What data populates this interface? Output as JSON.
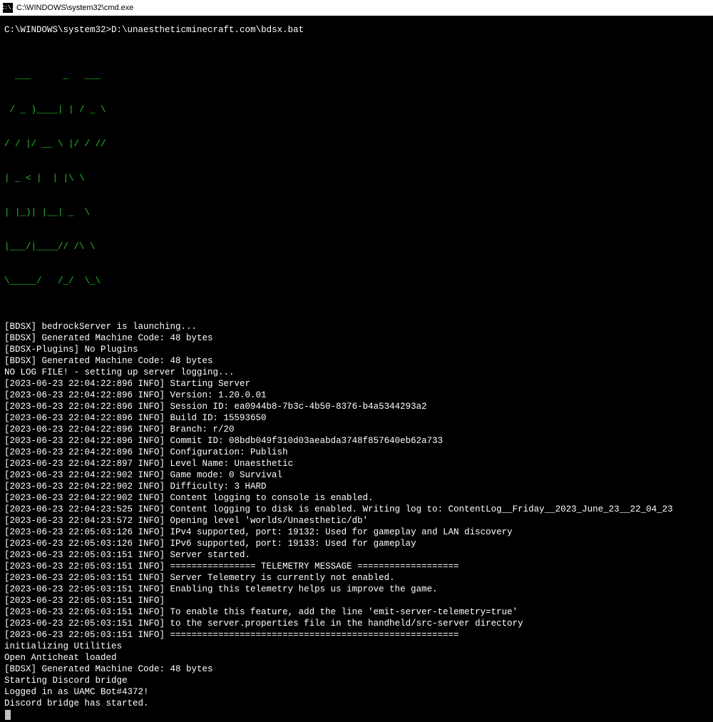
{
  "titlebar": {
    "text": "C:\\WINDOWS\\system32\\cmd.exe",
    "icon_label": "C:\\."
  },
  "prompt": {
    "path": "C:\\WINDOWS\\system32>",
    "cmd": "D:\\unaestheticminecraft.com\\bdsx.bat"
  },
  "logo": {
    "l1": "  ___      _   ___",
    "l2": " / _ )____| | / _ \\",
    "l3": "/ / |/ __ \\ |/ / //",
    "l4": "| _ < |  | |\\ \\",
    "l5": "| |_)| |__| _  \\",
    "l6": "|___/|____// /\\ \\",
    "l7": "\\_____/   /_/  \\_\\"
  },
  "lines": {
    "a01": "[BDSX] bedrockServer is launching...",
    "a02": "[BDSX] Generated Machine Code: 48 bytes",
    "a03": "[BDSX-Plugins] No Plugins",
    "a04": "[BDSX] Generated Machine Code: 48 bytes",
    "a05": "NO LOG FILE! - setting up server logging...",
    "a06": "[2023-06-23 22:04:22:896 INFO] Starting Server",
    "a07": "[2023-06-23 22:04:22:896 INFO] Version: 1.20.0.01",
    "a08": "[2023-06-23 22:04:22:896 INFO] Session ID: ea0944b8-7b3c-4b50-8376-b4a5344293a2",
    "a09": "[2023-06-23 22:04:22:896 INFO] Build ID: 15593650",
    "a10": "[2023-06-23 22:04:22:896 INFO] Branch: r/20",
    "a11": "[2023-06-23 22:04:22:896 INFO] Commit ID: 08bdb049f310d03aeabda3748f857640eb62a733",
    "a12": "[2023-06-23 22:04:22:896 INFO] Configuration: Publish",
    "a13": "[2023-06-23 22:04:22:897 INFO] Level Name: Unaesthetic",
    "a14": "[2023-06-23 22:04:22:902 INFO] Game mode: 0 Survival",
    "a15": "[2023-06-23 22:04:22:902 INFO] Difficulty: 3 HARD",
    "a16": "[2023-06-23 22:04:22:902 INFO] Content logging to console is enabled.",
    "a17": "[2023-06-23 22:04:23:525 INFO] Content logging to disk is enabled. Writing log to: ContentLog__Friday__2023_June_23__22_04_23",
    "a18": "[2023-06-23 22:04:23:572 INFO] Opening level 'worlds/Unaesthetic/db'",
    "a19": "[2023-06-23 22:05:03:126 INFO] IPv4 supported, port: 19132: Used for gameplay and LAN discovery",
    "a20": "[2023-06-23 22:05:03:126 INFO] IPv6 supported, port: 19133: Used for gameplay",
    "a21": "[2023-06-23 22:05:03:151 INFO] Server started.",
    "a22": "[2023-06-23 22:05:03:151 INFO] ================ TELEMETRY MESSAGE ===================",
    "a23": "[2023-06-23 22:05:03:151 INFO] Server Telemetry is currently not enabled.",
    "a24": "[2023-06-23 22:05:03:151 INFO] Enabling this telemetry helps us improve the game.",
    "a25": "[2023-06-23 22:05:03:151 INFO]",
    "a26": "[2023-06-23 22:05:03:151 INFO] To enable this feature, add the line 'emit-server-telemetry=true'",
    "a27": "[2023-06-23 22:05:03:151 INFO] to the server.properties file in the handheld/src-server directory",
    "a28": "[2023-06-23 22:05:03:151 INFO] ======================================================",
    "a29": "initializing Utilities",
    "a30": "Open Anticheat loaded",
    "a31": "[BDSX] Generated Machine Code: 48 bytes",
    "a32": "Starting Discord bridge",
    "a33": "Logged in as UAMC Bot#4372!",
    "a34": "Discord bridge has started."
  }
}
